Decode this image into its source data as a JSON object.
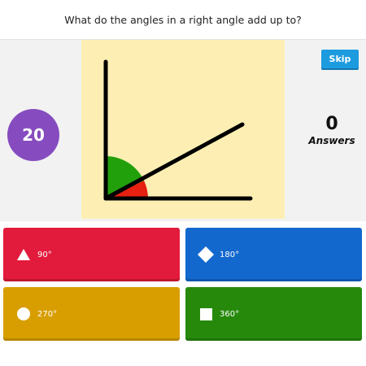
{
  "question": {
    "text": "What do the angles in a right angle add up to?"
  },
  "timer": {
    "value": "20"
  },
  "skip": {
    "label": "Skip"
  },
  "answers": {
    "count": "0",
    "label": "Answers"
  },
  "options": [
    {
      "label": "90°",
      "shape": "triangle-icon",
      "color": "#e21b3c"
    },
    {
      "label": "180°",
      "shape": "diamond-icon",
      "color": "#1368ce"
    },
    {
      "label": "270°",
      "shape": "circle-icon",
      "color": "#d89e00"
    },
    {
      "label": "360°",
      "shape": "square-icon",
      "color": "#26890c"
    }
  ],
  "colors": {
    "timer": "#864cbf",
    "skip": "#1d9bdf",
    "image_background": "#fdefb4",
    "angle_green": "#22a00c",
    "angle_red": "#e62111"
  }
}
